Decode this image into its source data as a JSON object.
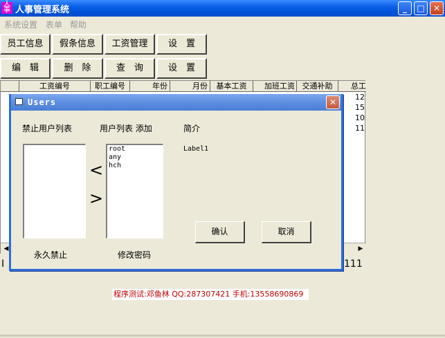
{
  "app": {
    "title": "人事管理系统",
    "icon_text": "人事"
  },
  "menu": [
    "系统设置",
    "表单",
    "帮助"
  ],
  "toolbar_row1": [
    "员工信息",
    "假条信息",
    "工资管理",
    "设　置"
  ],
  "toolbar_row2": [
    "编　辑",
    "删　除",
    "查　询",
    "设　置"
  ],
  "grid": {
    "headers": [
      "工资编号",
      "职工编号",
      "年份",
      "月份",
      "基本工资",
      "加班工资",
      "交通补助",
      "总工"
    ],
    "row_values": [
      "12",
      "15",
      "10",
      "11"
    ],
    "footer_left": "I",
    "footer_right": "111"
  },
  "dialog": {
    "title": "Users",
    "banned_label": "禁止用户列表",
    "users_label": "用户列表  添加",
    "intro_label": "简介",
    "info_label": "Label1",
    "users": [
      "root",
      "any",
      "hch"
    ],
    "banned_users": [],
    "move_left": "<",
    "move_right": ">",
    "permanent_ban": "永久禁止",
    "change_password": "修改密码",
    "ok": "确认",
    "cancel": "取消"
  },
  "status": "程序测试:邓鱼林 QQ:287307421 手机:13558690869",
  "icons": {
    "minimize": "minimize-icon",
    "maximize": "maximize-icon",
    "close": "close-icon",
    "window": "window-icon"
  }
}
